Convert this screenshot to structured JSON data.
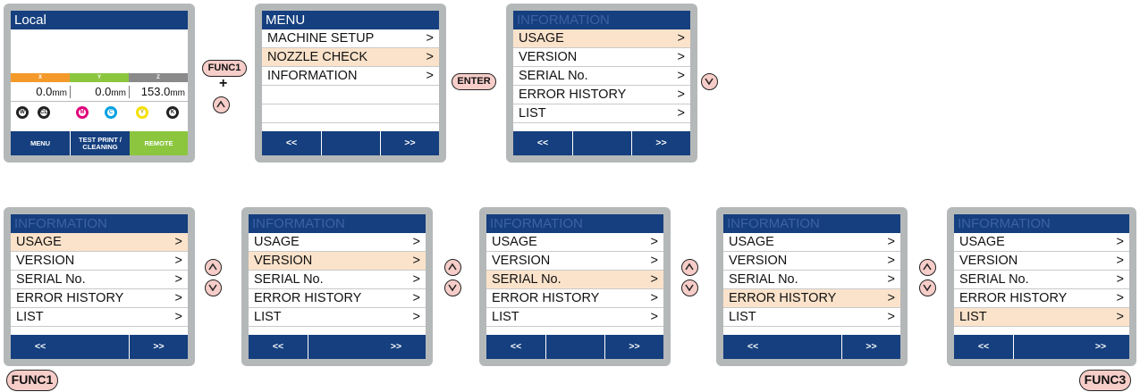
{
  "colors": {
    "title_bar": "#153f7e",
    "selected_row": "#fbe3cb",
    "frame": "#b5b8b9",
    "button_fill": "#f6cdc8",
    "axis_x": "#f39a2b",
    "axis_y": "#8cc63f",
    "axis_z": "#8a8a8a",
    "remote": "#8cc63f"
  },
  "local": {
    "title": "Local",
    "axes": [
      {
        "name": "X",
        "value": "0.0",
        "unit": "mm"
      },
      {
        "name": "Y",
        "value": "0.0",
        "unit": "mm"
      },
      {
        "name": "Z",
        "value": "153.0",
        "unit": "mm"
      }
    ],
    "inks": [
      "W",
      "CL",
      "M",
      "C",
      "Y",
      "K"
    ],
    "soft_keys": [
      "MENU",
      "TEST PRINT / CLEANING",
      "REMOTE"
    ]
  },
  "menu": {
    "title": "MENU",
    "items": [
      "MACHINE SETUP",
      "NOZZLE CHECK",
      "INFORMATION"
    ],
    "arrow": ">",
    "soft_keys": [
      "<<",
      ">>"
    ]
  },
  "information": {
    "title": "INFORMATION",
    "items": [
      "USAGE",
      "VERSION",
      "SERIAL No.",
      "ERROR HISTORY",
      "LIST"
    ],
    "arrow": ">",
    "soft_keys": [
      "<<",
      ">>"
    ]
  },
  "buttons": {
    "func1": "FUNC1",
    "func3": "FUNC3",
    "enter": "ENTER",
    "plus": "+",
    "up": "up-arrow-icon",
    "down": "down-arrow-icon"
  }
}
